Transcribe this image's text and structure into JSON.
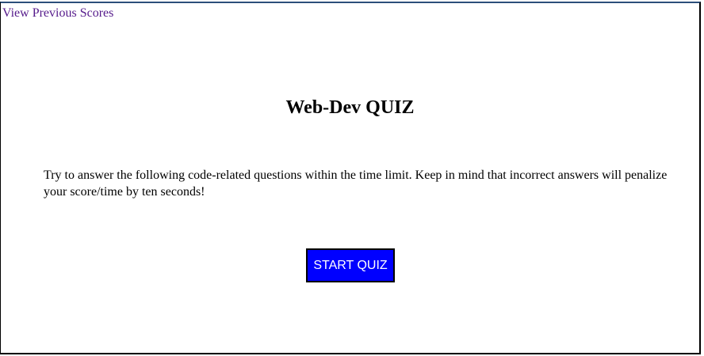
{
  "nav": {
    "scores_link": "View Previous Scores"
  },
  "main": {
    "title": "Web-Dev QUIZ",
    "instructions": "Try to answer the following code-related questions within the time limit. Keep in mind that incorrect answers will penalize your score/time by ten seconds!",
    "start_button": "START QUIZ"
  },
  "colors": {
    "link_visited": "#551a8b",
    "button_bg": "#0000ff",
    "button_text": "#ffffff"
  }
}
